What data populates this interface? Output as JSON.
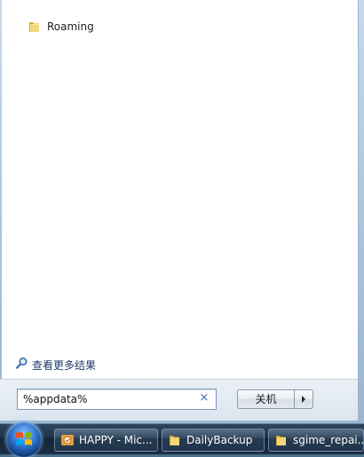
{
  "results": {
    "items": [
      {
        "label": "Roaming",
        "icon": "folder-icon"
      }
    ],
    "see_more_label": "查看更多结果"
  },
  "search": {
    "value": "%appdata%",
    "clear_symbol": "×"
  },
  "shutdown": {
    "label": "关机"
  },
  "taskbar": {
    "buttons": [
      {
        "label": "HAPPY - Mic...",
        "icon": "outlook-icon"
      },
      {
        "label": "DailyBackup",
        "icon": "folder-icon"
      },
      {
        "label": "sgime_repai...",
        "icon": "folder-icon"
      }
    ]
  },
  "colors": {
    "accent": "#3b6fb6",
    "taskbar": "#1f3247",
    "folder": "#e8c65a"
  }
}
